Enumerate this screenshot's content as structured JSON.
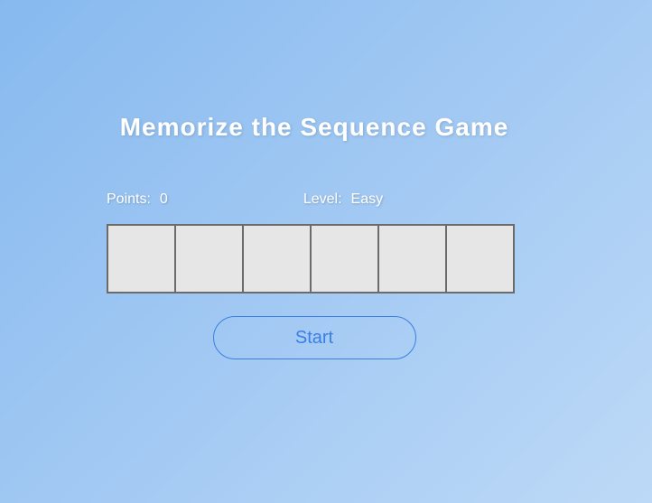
{
  "title": "Memorize the Sequence Game",
  "stats": {
    "points_label": "Points:",
    "points_value": "0",
    "level_label": "Level:",
    "level_value": "Easy"
  },
  "boxes": {
    "count": 6
  },
  "start_label": "Start"
}
